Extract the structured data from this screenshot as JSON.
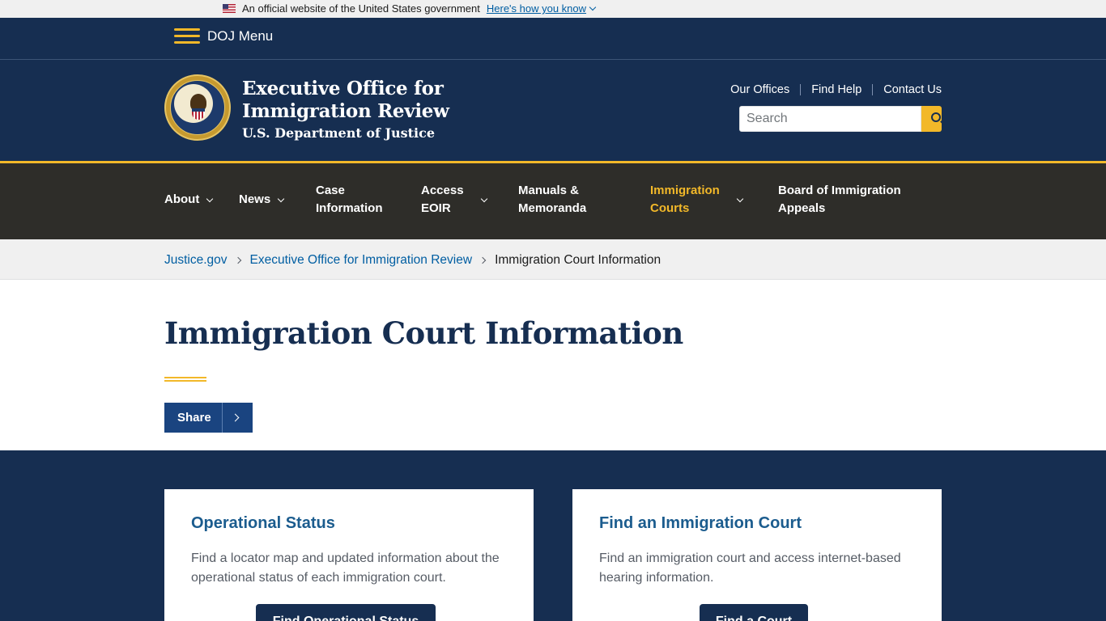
{
  "gov_banner": {
    "text": "An official website of the United States government",
    "link": "Here's how you know"
  },
  "doj_menu": {
    "label": "DOJ Menu"
  },
  "header": {
    "title_line1": "Executive Office for",
    "title_line2": "Immigration Review",
    "subtitle": "U.S. Department of Justice",
    "utility_links": [
      "Our Offices",
      "Find Help",
      "Contact Us"
    ],
    "search_placeholder": "Search"
  },
  "nav": {
    "items": [
      {
        "label": "About",
        "has_dropdown": true
      },
      {
        "label": "News",
        "has_dropdown": true
      },
      {
        "label_line1": "Case",
        "label_line2": "Information",
        "has_dropdown": false
      },
      {
        "label_line1": "Access",
        "label_line2": "EOIR",
        "has_dropdown": true
      },
      {
        "label_line1": "Manuals &",
        "label_line2": "Memoranda",
        "has_dropdown": false
      },
      {
        "label_line1": "Immigration",
        "label_line2": "Courts",
        "has_dropdown": true,
        "active": true
      },
      {
        "label_line1": "Board of Immigration",
        "label_line2": "Appeals",
        "has_dropdown": false
      }
    ]
  },
  "breadcrumb": {
    "items": [
      "Justice.gov",
      "Executive Office for Immigration Review"
    ],
    "current": "Immigration Court Information"
  },
  "page": {
    "title": "Immigration Court Information",
    "share_label": "Share"
  },
  "cards": [
    {
      "title": "Operational Status",
      "text": "Find a locator map and updated information about the operational status of each immigration court.",
      "button": "Find Operational Status"
    },
    {
      "title": "Find an Immigration Court",
      "text": "Find an immigration court and access internet-based hearing information.",
      "button": "Find a Court"
    }
  ],
  "colors": {
    "navy": "#162e51",
    "gold": "#f2b829",
    "nav_bg": "#2e2d29",
    "link_blue": "#005ea2"
  }
}
